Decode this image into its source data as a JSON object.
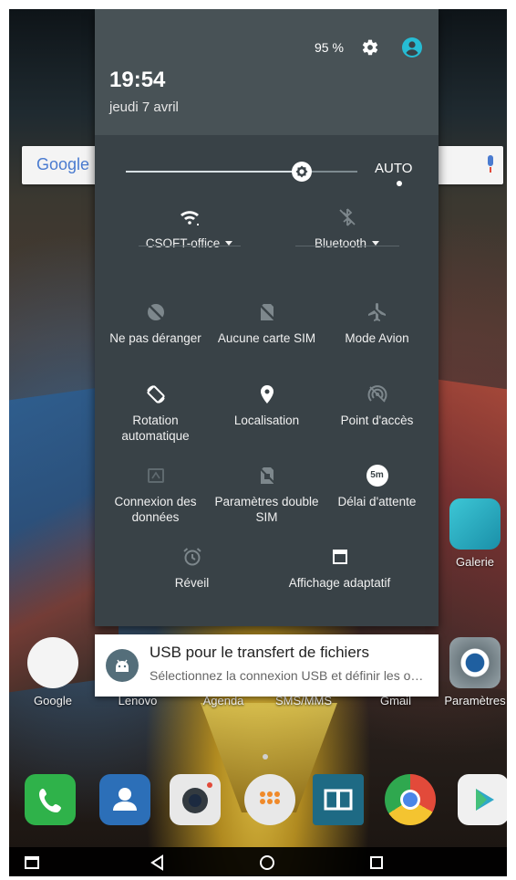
{
  "status": {
    "battery": "95 %",
    "time": "19:54",
    "date": "jeudi 7 avril"
  },
  "brightness": {
    "level": 0.76,
    "auto_label": "AUTO"
  },
  "search": {
    "google_label": "Google"
  },
  "quick_settings": {
    "wifi_label": "CSOFT-office",
    "bluetooth_label": "Bluetooth",
    "tiles": [
      {
        "label": "Ne pas déranger",
        "icon": "do-not-disturb-icon",
        "active": false
      },
      {
        "label": "Aucune carte SIM",
        "icon": "no-sim-icon",
        "active": false
      },
      {
        "label": "Mode Avion",
        "icon": "airplane-icon",
        "active": false
      },
      {
        "label": "Rotation automatique",
        "icon": "auto-rotate-icon",
        "active": true
      },
      {
        "label": "Localisation",
        "icon": "location-icon",
        "active": true
      },
      {
        "label": "Point d'accès",
        "icon": "hotspot-icon",
        "active": false
      },
      {
        "label": "Connexion des données",
        "icon": "mobile-data-icon",
        "active": false
      },
      {
        "label": "Paramètres double SIM",
        "icon": "dual-sim-icon",
        "active": false
      },
      {
        "label": "Délai d'attente",
        "icon": "timeout-icon",
        "active": true,
        "badge": "5m"
      },
      {
        "label": "Réveil",
        "icon": "alarm-icon",
        "active": false
      },
      {
        "label": "Affichage adaptatif",
        "icon": "adaptive-display-icon",
        "active": true
      }
    ]
  },
  "notification": {
    "title": "USB pour le transfert de fichiers",
    "text": "Sélectionnez la connexion USB et définir les options"
  },
  "home": {
    "apps": [
      {
        "label": "Google"
      },
      {
        "label": "Lenovo"
      },
      {
        "label": "Agenda"
      },
      {
        "label": "SMS/MMS"
      },
      {
        "label": "Gmail"
      },
      {
        "label": "Paramètres"
      }
    ],
    "side_app": "Galerie"
  }
}
